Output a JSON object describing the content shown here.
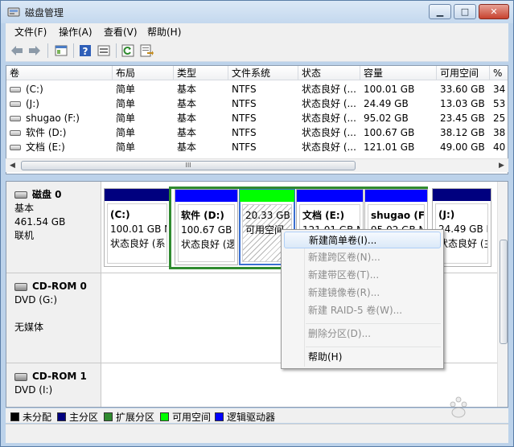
{
  "window": {
    "title": "磁盘管理",
    "icon": "disk-management-icon"
  },
  "menu": [
    "文件(F)",
    "操作(A)",
    "查看(V)",
    "帮助(H)"
  ],
  "toolbar": {
    "icons": [
      "back-arrow-icon",
      "forward-arrow-icon",
      "console-tree-icon",
      "help-icon",
      "properties-icon",
      "refresh-icon",
      "export-icon"
    ]
  },
  "volume_table": {
    "columns": [
      "卷",
      "布局",
      "类型",
      "文件系统",
      "状态",
      "容量",
      "可用空间",
      "%"
    ],
    "rows": [
      [
        "(C:)",
        "简单",
        "基本",
        "NTFS",
        "状态良好 (...",
        "100.01 GB",
        "33.60 GB",
        "34"
      ],
      [
        "(J:)",
        "简单",
        "基本",
        "NTFS",
        "状态良好 (...",
        "24.49 GB",
        "13.03 GB",
        "53"
      ],
      [
        "shugao (F:)",
        "简单",
        "基本",
        "NTFS",
        "状态良好 (...",
        "95.02 GB",
        "23.45 GB",
        "25"
      ],
      [
        "软件 (D:)",
        "简单",
        "基本",
        "NTFS",
        "状态良好 (...",
        "100.67 GB",
        "38.12 GB",
        "38"
      ],
      [
        "文档 (E:)",
        "简单",
        "基本",
        "NTFS",
        "状态良好 (...",
        "121.01 GB",
        "49.00 GB",
        "40"
      ]
    ],
    "scroll_thumb_text": "III"
  },
  "disks": [
    {
      "name": "磁盘 0",
      "type": "基本",
      "size": "461.54 GB",
      "status": "联机"
    },
    {
      "name": "CD-ROM 0",
      "type": "DVD (G:)",
      "status": "无媒体"
    },
    {
      "name": "CD-ROM 1",
      "type": "DVD (I:)"
    }
  ],
  "partitions": [
    {
      "title": "(C:)",
      "size": "100.01 GB N",
      "status": "状态良好 (系",
      "bar_color": "#00007f"
    },
    {
      "title": "软件 (D:)",
      "size": "100.67 GB",
      "status": "状态良好 (逻",
      "bar_color": "#0000ff"
    },
    {
      "title": "",
      "size": "20.33 GB",
      "status": "可用空间",
      "bar_color": "#00ff00"
    },
    {
      "title": "文档 (E:)",
      "size": "121.01 GB N",
      "status": "",
      "bar_color": "#0000ff"
    },
    {
      "title": "shugao (F",
      "size": "95.02 GB N",
      "status": "",
      "bar_color": "#0000ff"
    },
    {
      "title": "(J:)",
      "size": "24.49 GB N",
      "status": "状态良好 (主",
      "bar_color": "#00007f"
    }
  ],
  "context_menu": {
    "items": [
      {
        "label": "新建简单卷(I)...",
        "enabled": true,
        "highlighted": true
      },
      {
        "label": "新建跨区卷(N)...",
        "enabled": false
      },
      {
        "label": "新建带区卷(T)...",
        "enabled": false
      },
      {
        "label": "新建镜像卷(R)...",
        "enabled": false
      },
      {
        "label": "新建 RAID-5 卷(W)...",
        "enabled": false
      },
      {
        "label": "删除分区(D)...",
        "enabled": false
      },
      {
        "label": "帮助(H)",
        "enabled": true
      }
    ]
  },
  "legend": [
    {
      "label": "未分配",
      "color": "#000000"
    },
    {
      "label": "主分区",
      "color": "#00007f"
    },
    {
      "label": "扩展分区",
      "color": "#2f8a2f"
    },
    {
      "label": "可用空间",
      "color": "#00ff00"
    },
    {
      "label": "逻辑驱动器",
      "color": "#0000ff"
    }
  ]
}
